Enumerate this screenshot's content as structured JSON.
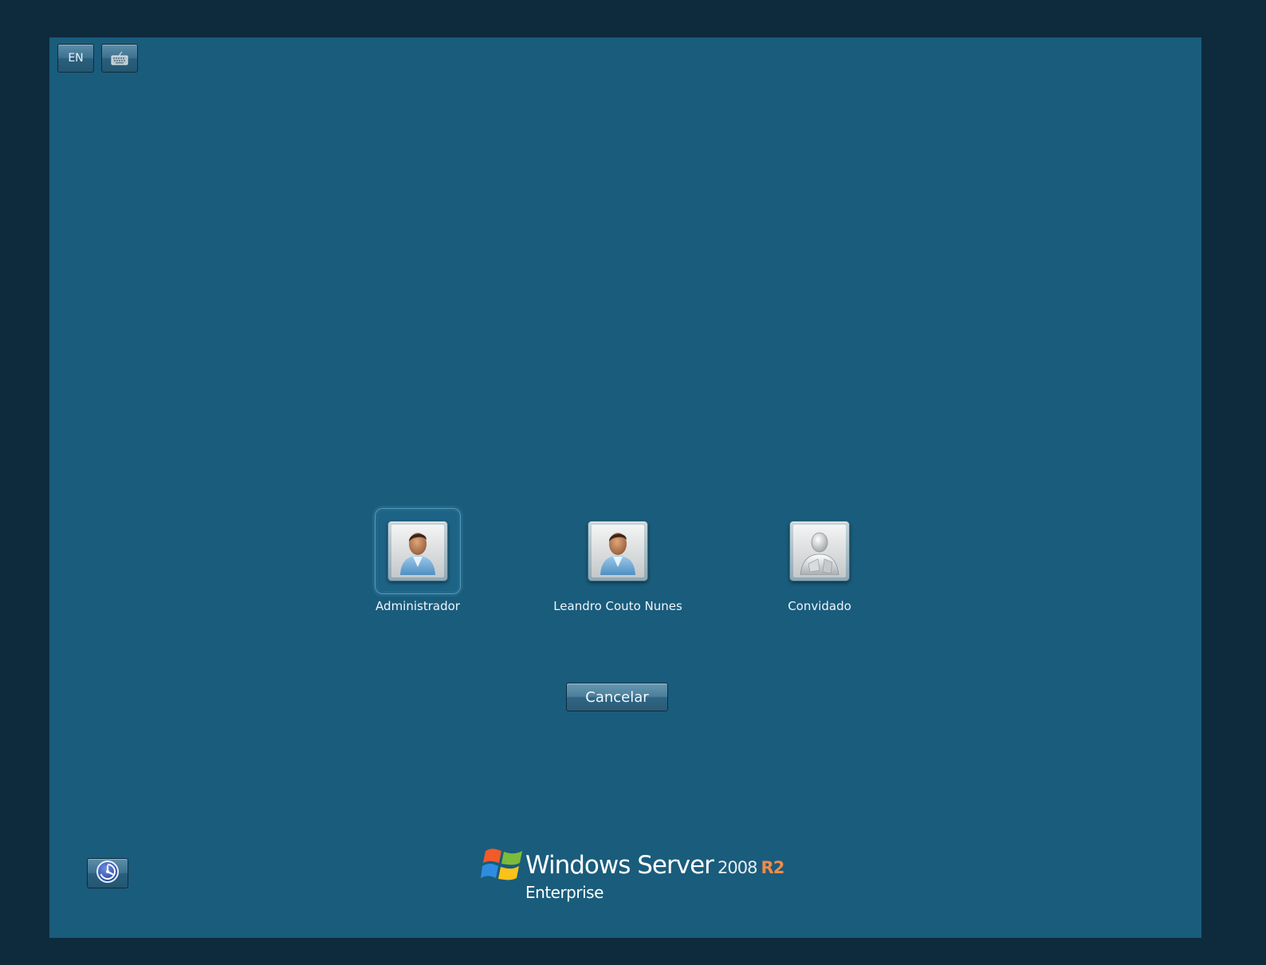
{
  "topbar": {
    "language_label": "EN",
    "keyboard_icon": "keyboard-icon"
  },
  "users": [
    {
      "name": "Administrador",
      "icon": "user-avatar-icon",
      "selected": true
    },
    {
      "name": "Leandro Couto Nunes",
      "icon": "user-avatar-icon",
      "selected": false
    },
    {
      "name": "Convidado",
      "icon": "guest-avatar-icon",
      "selected": false
    }
  ],
  "actions": {
    "cancel_label": "Cancelar"
  },
  "ease_of_access": {
    "icon": "ease-of-access-icon"
  },
  "branding": {
    "product_name": "Windows Server",
    "year": "2008",
    "release": "R2",
    "edition": "Enterprise",
    "logo_icon": "windows-flag-icon"
  },
  "colors": {
    "outer_background": "#0e2b3e",
    "screen_background": "#1a5c7c",
    "release_accent": "#f08a4b"
  }
}
